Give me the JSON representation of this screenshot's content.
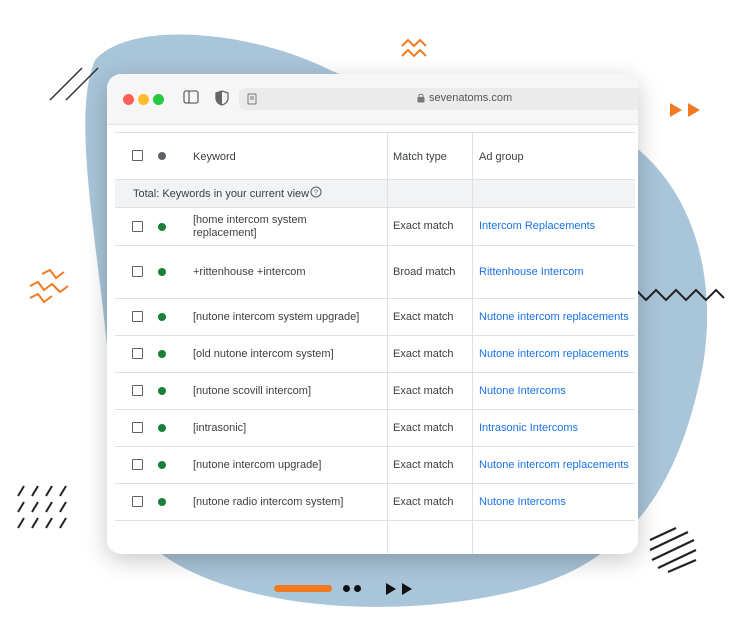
{
  "browser": {
    "url": "sevenatoms.com"
  },
  "table": {
    "headers": {
      "keyword": "Keyword",
      "match_type": "Match type",
      "ad_group": "Ad group"
    },
    "total_label": "Total: Keywords in your current view",
    "rows": [
      {
        "keyword": "[home intercom system replacement]",
        "match_type": "Exact match",
        "ad_group": "Intercom Replacements"
      },
      {
        "keyword": "+rittenhouse +intercom",
        "match_type": "Broad match",
        "ad_group": "Rittenhouse Intercom"
      },
      {
        "keyword": "[nutone intercom system upgrade]",
        "match_type": "Exact match",
        "ad_group": "Nutone intercom replacements"
      },
      {
        "keyword": "[old nutone intercom system]",
        "match_type": "Exact match",
        "ad_group": "Nutone intercom replacements"
      },
      {
        "keyword": "[nutone scovill intercom]",
        "match_type": "Exact match",
        "ad_group": "Nutone Intercoms"
      },
      {
        "keyword": "[intrasonic]",
        "match_type": "Exact match",
        "ad_group": "Intrasonic Intercoms"
      },
      {
        "keyword": "[nutone intercom upgrade]",
        "match_type": "Exact match",
        "ad_group": "Nutone intercom replacements"
      },
      {
        "keyword": "[nutone radio intercom system]",
        "match_type": "Exact match",
        "ad_group": "Nutone Intercoms"
      }
    ]
  },
  "colors": {
    "status_enabled": "#188038",
    "link": "#1a73e8",
    "blob": "#a9c5d9",
    "accent_orange": "#f07a22"
  }
}
